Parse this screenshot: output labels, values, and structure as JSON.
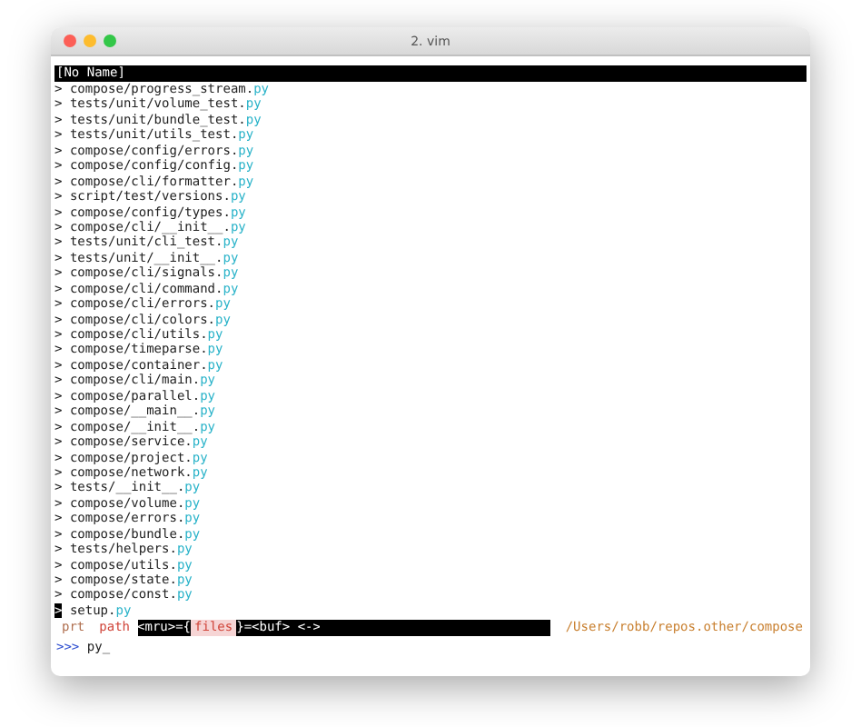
{
  "window": {
    "title": "2. vim"
  },
  "buffer_title": "[No Name]",
  "files": [
    {
      "marker": ">",
      "path": "compose/progress_stream.",
      "ext": "py",
      "selected": false
    },
    {
      "marker": ">",
      "path": "tests/unit/volume_test.",
      "ext": "py",
      "selected": false
    },
    {
      "marker": ">",
      "path": "tests/unit/bundle_test.",
      "ext": "py",
      "selected": false
    },
    {
      "marker": ">",
      "path": "tests/unit/utils_test.",
      "ext": "py",
      "selected": false
    },
    {
      "marker": ">",
      "path": "compose/config/errors.",
      "ext": "py",
      "selected": false
    },
    {
      "marker": ">",
      "path": "compose/config/config.",
      "ext": "py",
      "selected": false
    },
    {
      "marker": ">",
      "path": "compose/cli/formatter.",
      "ext": "py",
      "selected": false
    },
    {
      "marker": ">",
      "path": "script/test/versions.",
      "ext": "py",
      "selected": false
    },
    {
      "marker": ">",
      "path": "compose/config/types.",
      "ext": "py",
      "selected": false
    },
    {
      "marker": ">",
      "path": "compose/cli/__init__.",
      "ext": "py",
      "selected": false
    },
    {
      "marker": ">",
      "path": "tests/unit/cli_test.",
      "ext": "py",
      "selected": false
    },
    {
      "marker": ">",
      "path": "tests/unit/__init__.",
      "ext": "py",
      "selected": false
    },
    {
      "marker": ">",
      "path": "compose/cli/signals.",
      "ext": "py",
      "selected": false
    },
    {
      "marker": ">",
      "path": "compose/cli/command.",
      "ext": "py",
      "selected": false
    },
    {
      "marker": ">",
      "path": "compose/cli/errors.",
      "ext": "py",
      "selected": false
    },
    {
      "marker": ">",
      "path": "compose/cli/colors.",
      "ext": "py",
      "selected": false
    },
    {
      "marker": ">",
      "path": "compose/cli/utils.",
      "ext": "py",
      "selected": false
    },
    {
      "marker": ">",
      "path": "compose/timeparse.",
      "ext": "py",
      "selected": false
    },
    {
      "marker": ">",
      "path": "compose/container.",
      "ext": "py",
      "selected": false
    },
    {
      "marker": ">",
      "path": "compose/cli/main.",
      "ext": "py",
      "selected": false
    },
    {
      "marker": ">",
      "path": "compose/parallel.",
      "ext": "py",
      "selected": false
    },
    {
      "marker": ">",
      "path": "compose/__main__.",
      "ext": "py",
      "selected": false
    },
    {
      "marker": ">",
      "path": "compose/__init__.",
      "ext": "py",
      "selected": false
    },
    {
      "marker": ">",
      "path": "compose/service.",
      "ext": "py",
      "selected": false
    },
    {
      "marker": ">",
      "path": "compose/project.",
      "ext": "py",
      "selected": false
    },
    {
      "marker": ">",
      "path": "compose/network.",
      "ext": "py",
      "selected": false
    },
    {
      "marker": ">",
      "path": "tests/__init__.",
      "ext": "py",
      "selected": false
    },
    {
      "marker": ">",
      "path": "compose/volume.",
      "ext": "py",
      "selected": false
    },
    {
      "marker": ">",
      "path": "compose/errors.",
      "ext": "py",
      "selected": false
    },
    {
      "marker": ">",
      "path": "compose/bundle.",
      "ext": "py",
      "selected": false
    },
    {
      "marker": ">",
      "path": "tests/helpers.",
      "ext": "py",
      "selected": false
    },
    {
      "marker": ">",
      "path": "compose/utils.",
      "ext": "py",
      "selected": false
    },
    {
      "marker": ">",
      "path": "compose/state.",
      "ext": "py",
      "selected": false
    },
    {
      "marker": ">",
      "path": "compose/const.",
      "ext": "py",
      "selected": false
    },
    {
      "marker": ">",
      "path": "setup.",
      "ext": "py",
      "selected": true
    }
  ],
  "status_line": {
    "modes": [
      {
        "label": "prt",
        "selected": false
      },
      {
        "label": "path",
        "selected": true
      }
    ],
    "left": "<mru>={",
    "current": "files",
    "right": "}=<buf> <->",
    "cwd": "/Users/robb/repos.other/compose"
  },
  "prompt": {
    "marker": ">>>",
    "value": "py",
    "cursor": "_"
  }
}
